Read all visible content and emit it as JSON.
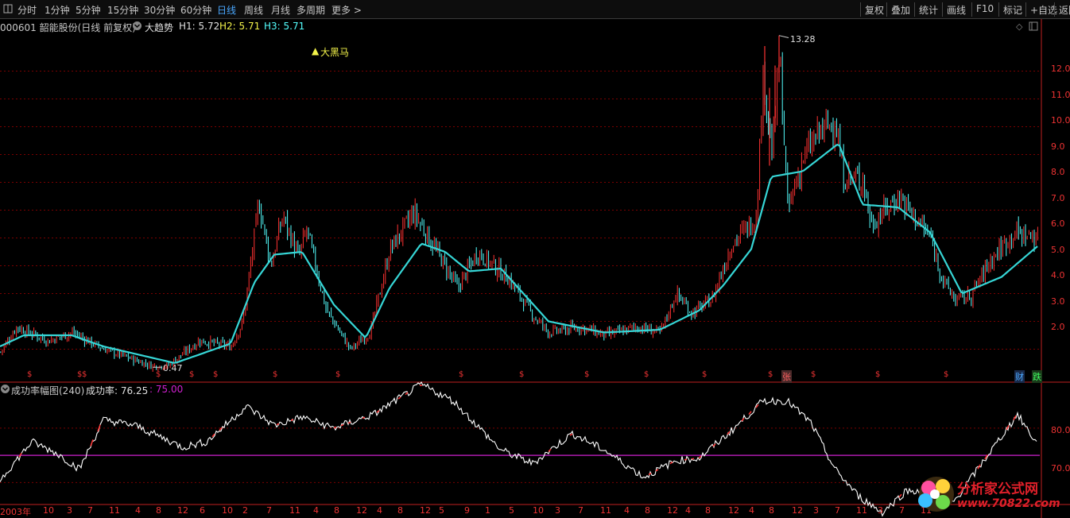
{
  "toolbar": {
    "left_items": [
      "分时",
      "1分钟",
      "5分钟",
      "15分钟",
      "30分钟",
      "60分钟",
      "日线",
      "周线",
      "月线",
      "多周期",
      "更多 >"
    ],
    "active": "日线",
    "right_items": [
      "复权",
      "叠加",
      "统计",
      "画线",
      "F10",
      "标记",
      "+自选",
      "返回"
    ]
  },
  "main_info": {
    "stock": "000601 韶能股份(日线 前复权)",
    "indicator": "大趋势",
    "h1": "H1: 5.72",
    "h2": "H2: 5.71",
    "h3": "H3: 5.71",
    "signal": "大黑马",
    "max_label": "13.28",
    "min_label": "0.47"
  },
  "sub_info": {
    "indicator": "成功率幅图(240)",
    "value_label": "成功率: 76.25",
    "ref_label": ": 75.00"
  },
  "axis": {
    "main_ticks": [
      "12.0",
      "11.0",
      "10.0",
      "9.0",
      "8.0",
      "7.0",
      "6.0",
      "5.0",
      "4.0",
      "3.0",
      "2.0"
    ],
    "sub_ticks": [
      "80.0",
      "70.0"
    ],
    "x_ticks": [
      "2003年",
      "10",
      "3",
      "7",
      "11",
      "4",
      "8",
      "12",
      "6",
      "10",
      "2",
      "7",
      "11",
      "4",
      "8",
      "12",
      "4",
      "8",
      "12",
      "5",
      "9",
      "1",
      "5",
      "10",
      "3",
      "7",
      "11",
      "4",
      "8",
      "12",
      "4",
      "8",
      "12",
      "4",
      "8",
      "12",
      "3",
      "7",
      "11",
      "3",
      "7",
      "11"
    ]
  },
  "markers": {
    "dollar": "$",
    "up": "张",
    "fin": "财",
    "down": "跌"
  },
  "watermark": {
    "title": "分析家公式网",
    "url": "www.70822.com"
  },
  "colors": {
    "background": "#000000",
    "up_candle": "#ff3232",
    "down_candle": "#54ffff",
    "ma_line": "#36d6d6",
    "grid": "#7a0000",
    "success_line": "#ffffff",
    "ref_line": "#d020d0",
    "active_tab": "#4aa8ff"
  },
  "chart_data": [
    {
      "type": "candlestick",
      "title": "000601 韶能股份(日线 前复权)",
      "ylim": [
        1.3,
        13.3
      ],
      "y_ticks": [
        2,
        3,
        4,
        5,
        6,
        7,
        8,
        9,
        10,
        11,
        12
      ],
      "max": 13.28,
      "min": 0.47,
      "close_keypoints": [
        [
          0,
          1.9
        ],
        [
          20,
          2.8
        ],
        [
          60,
          2.3
        ],
        [
          90,
          2.6
        ],
        [
          130,
          2.0
        ],
        [
          190,
          1.4
        ],
        [
          210,
          1.4
        ],
        [
          250,
          2.3
        ],
        [
          290,
          2.1
        ],
        [
          305,
          3.0
        ],
        [
          325,
          7.3
        ],
        [
          340,
          5.0
        ],
        [
          355,
          6.8
        ],
        [
          375,
          5.3
        ],
        [
          385,
          6.3
        ],
        [
          410,
          3.4
        ],
        [
          440,
          2.0
        ],
        [
          465,
          2.6
        ],
        [
          490,
          5.6
        ],
        [
          520,
          6.9
        ],
        [
          555,
          5.2
        ],
        [
          575,
          4.2
        ],
        [
          600,
          5.5
        ],
        [
          640,
          4.5
        ],
        [
          670,
          3.2
        ],
        [
          690,
          2.6
        ],
        [
          730,
          2.8
        ],
        [
          760,
          2.5
        ],
        [
          800,
          2.8
        ],
        [
          830,
          2.6
        ],
        [
          850,
          4.0
        ],
        [
          870,
          3.3
        ],
        [
          895,
          3.8
        ],
        [
          920,
          5.8
        ],
        [
          950,
          6.7
        ],
        [
          960,
          12.0
        ],
        [
          970,
          9.0
        ],
        [
          980,
          12.6
        ],
        [
          990,
          7.0
        ],
        [
          1010,
          8.9
        ],
        [
          1030,
          9.8
        ],
        [
          1050,
          10.2
        ],
        [
          1060,
          8.2
        ],
        [
          1085,
          8.1
        ],
        [
          1095,
          6.5
        ],
        [
          1130,
          7.5
        ],
        [
          1170,
          6.0
        ],
        [
          1185,
          4.5
        ],
        [
          1200,
          3.8
        ],
        [
          1220,
          3.9
        ],
        [
          1245,
          5.2
        ],
        [
          1275,
          6.2
        ],
        [
          1305,
          6.0
        ]
      ],
      "ma_keypoints": [
        [
          0,
          2.1
        ],
        [
          30,
          2.5
        ],
        [
          90,
          2.5
        ],
        [
          130,
          2.1
        ],
        [
          220,
          1.5
        ],
        [
          290,
          2.2
        ],
        [
          320,
          4.4
        ],
        [
          345,
          5.4
        ],
        [
          380,
          5.5
        ],
        [
          420,
          3.6
        ],
        [
          460,
          2.4
        ],
        [
          490,
          4.2
        ],
        [
          530,
          5.8
        ],
        [
          560,
          5.5
        ],
        [
          590,
          4.8
        ],
        [
          630,
          4.9
        ],
        [
          690,
          3.0
        ],
        [
          760,
          2.6
        ],
        [
          830,
          2.7
        ],
        [
          880,
          3.4
        ],
        [
          910,
          4.3
        ],
        [
          945,
          5.6
        ],
        [
          970,
          8.2
        ],
        [
          990,
          8.3
        ],
        [
          1010,
          8.4
        ],
        [
          1055,
          9.4
        ],
        [
          1085,
          7.2
        ],
        [
          1130,
          7.1
        ],
        [
          1170,
          6.2
        ],
        [
          1210,
          4.0
        ],
        [
          1260,
          4.6
        ],
        [
          1305,
          5.7
        ]
      ]
    },
    {
      "type": "line",
      "title": "成功率幅图(240)",
      "ylim": [
        67,
        88
      ],
      "y_ticks": [
        70,
        80
      ],
      "ref_value": 75.0,
      "last_value": 76.25,
      "series_keypoints": [
        [
          0,
          70.5
        ],
        [
          40,
          77.5
        ],
        [
          70,
          75.5
        ],
        [
          100,
          72.5
        ],
        [
          130,
          81.5
        ],
        [
          170,
          80.5
        ],
        [
          230,
          76.5
        ],
        [
          260,
          77.5
        ],
        [
          310,
          84.0
        ],
        [
          345,
          80.5
        ],
        [
          380,
          82.0
        ],
        [
          420,
          80.0
        ],
        [
          470,
          82.5
        ],
        [
          530,
          88.0
        ],
        [
          570,
          85.0
        ],
        [
          630,
          76.0
        ],
        [
          670,
          73.5
        ],
        [
          720,
          79.0
        ],
        [
          760,
          76.0
        ],
        [
          810,
          71.0
        ],
        [
          850,
          74.0
        ],
        [
          880,
          74.5
        ],
        [
          920,
          79.5
        ],
        [
          960,
          85.0
        ],
        [
          990,
          85.0
        ],
        [
          1020,
          81.0
        ],
        [
          1050,
          72.5
        ],
        [
          1080,
          67.5
        ],
        [
          1110,
          64.5
        ],
        [
          1140,
          68.5
        ],
        [
          1170,
          68.5
        ],
        [
          1200,
          66.5
        ],
        [
          1240,
          74.5
        ],
        [
          1280,
          82.5
        ],
        [
          1305,
          77.0
        ]
      ]
    }
  ]
}
